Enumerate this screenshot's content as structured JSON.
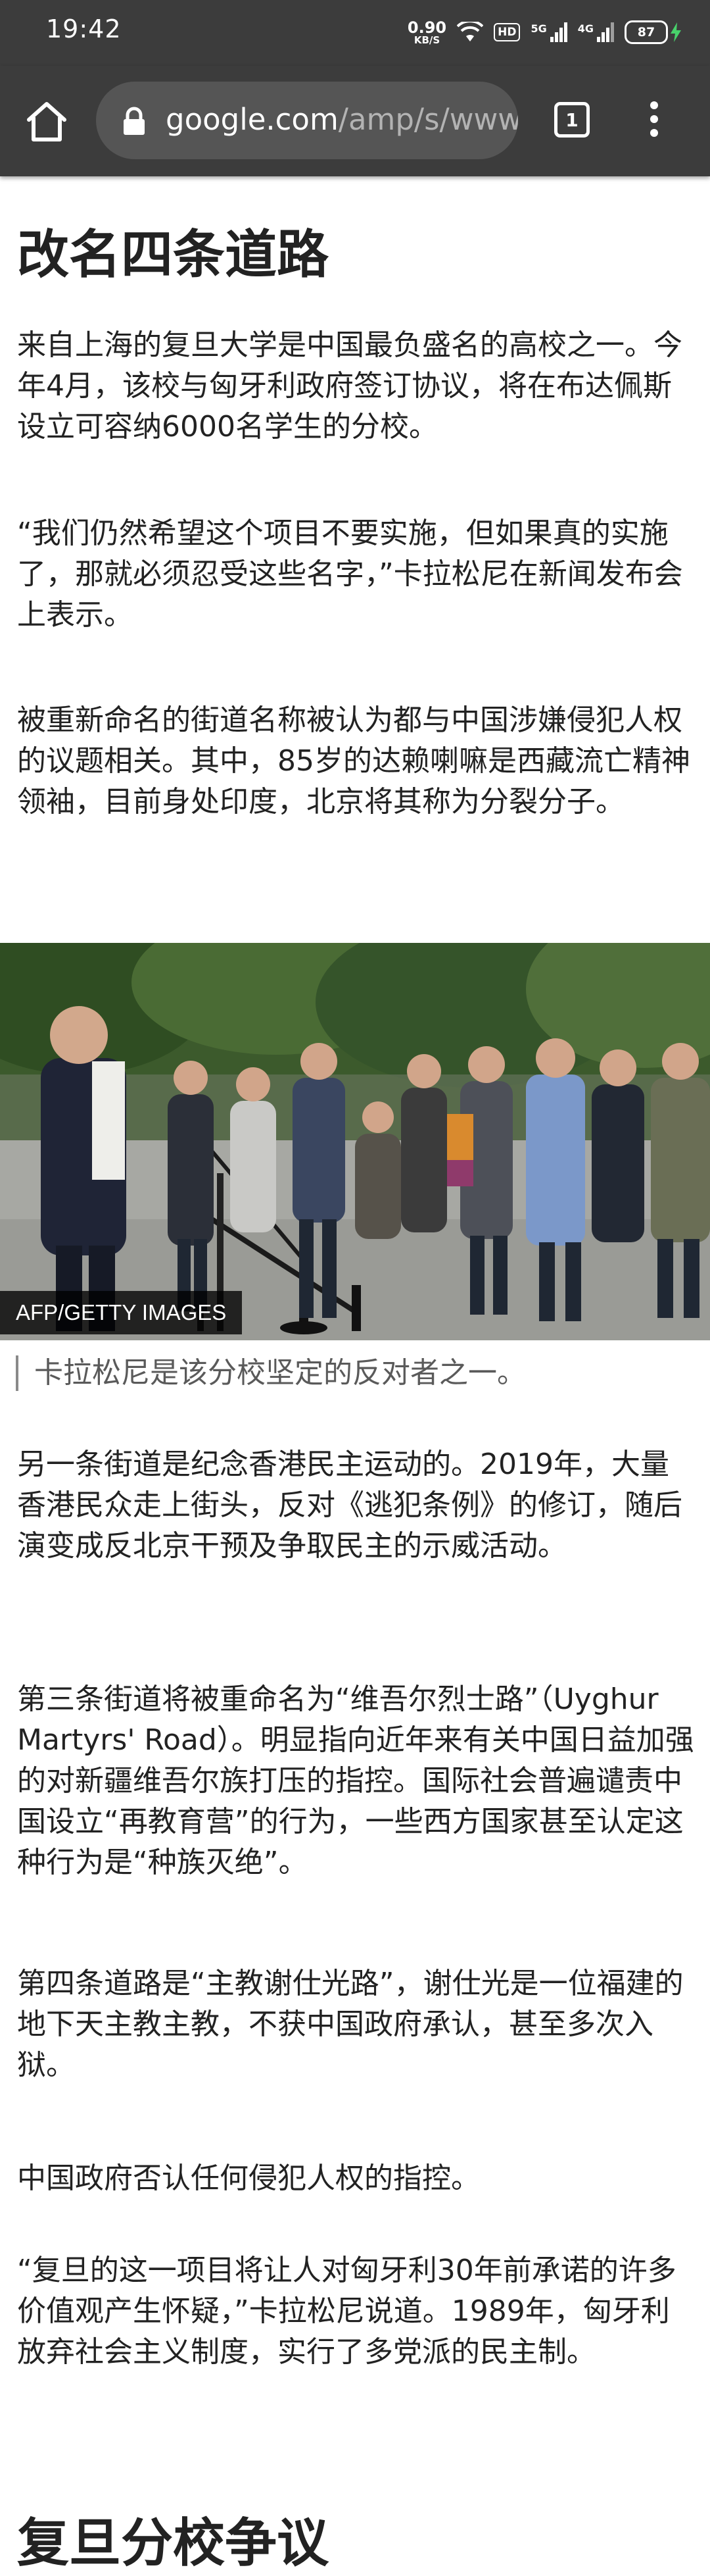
{
  "status_bar": {
    "time": "19:42",
    "net_speed_value": "0.90",
    "net_speed_unit": "KB/S",
    "hd_badge": "HD",
    "sim1_label": "5G",
    "sim2_label": "4G",
    "battery_percent": "87"
  },
  "browser": {
    "url_domain": "google.com",
    "url_path": "/amp/s/www",
    "tab_count": "1"
  },
  "article": {
    "section1_heading": "改名四条道路",
    "paragraphs1": [
      "来自上海的复旦大学是中国最负盛名的高校之一。今年4月，该校与匈牙利政府签订协议，将在布达佩斯设立可容纳6000名学生的分校。",
      "“我们仍然希望这个项目不要实施，但如果真的实施了，那就必须忍受这些名字，”卡拉松尼在新闻发布会上表示。",
      "被重新命名的街道名称被认为都与中国涉嫌侵犯人权的议题相关。其中，85岁的达赖喇嘛是西藏流亡精神领袖，目前身处印度，北京将其称为分裂分子。"
    ],
    "photo_credit": "AFP/GETTY IMAGES",
    "photo_caption": "卡拉松尼是该分校坚定的反对者之一。",
    "paragraphs2": [
      "另一条街道是纪念香港民主运动的。2019年，大量香港民众走上街头，反对《逃犯条例》的修订，随后演变成反北京干预及争取民主的示威活动。",
      "第三条街道将被重命名为“维吾尔烈士路”（Uyghur Martyrs' Road）。明显指向近年来有关中国日益加强的对新疆维吾尔族打压的指控。国际社会普遍谴责中国设立“再教育营”的行为，一些西方国家甚至认定这种行为是“种族灭绝”。",
      "第四条道路是“主教谢仕光路”，谢仕光是一位福建的地下天主教主教，不获中国政府承认，甚至多次入狱。",
      "中国政府否认任何侵犯人权的指控。",
      "“复旦的这一项目将让人对匈牙利30年前承诺的许多价值观产生怀疑，”卡拉松尼说道。1989年，匈牙利放弃社会主义制度，实行了多党派的民主制。"
    ],
    "section2_heading": "复旦分校争议"
  }
}
